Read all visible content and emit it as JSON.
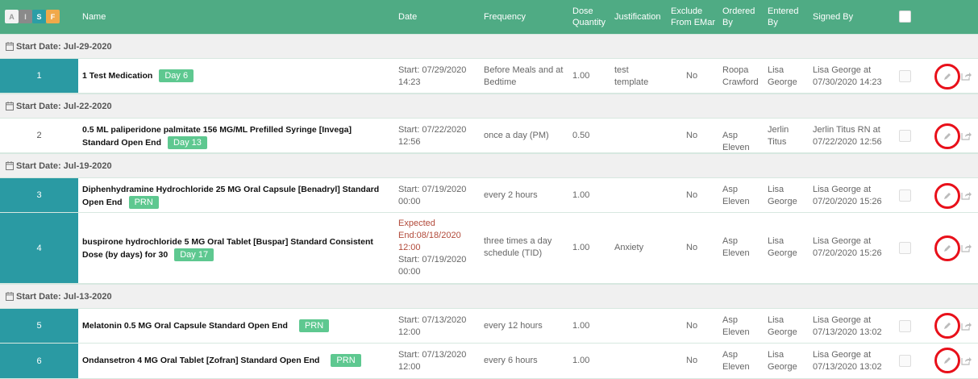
{
  "status_keys": [
    "A",
    "I",
    "S",
    "F"
  ],
  "columns": {
    "name": "Name",
    "date": "Date",
    "frequency": "Frequency",
    "dose_quantity": "Dose Quantity",
    "justification": "Justification",
    "exclude_emar": "Exclude From EMar",
    "ordered_by": "Ordered By",
    "entered_by": "Entered By",
    "signed_by": "Signed By"
  },
  "groups": [
    {
      "label": "Start Date: Jul-29-2020"
    },
    {
      "label": "Start Date: Jul-22-2020"
    },
    {
      "label": "Start Date: Jul-19-2020"
    },
    {
      "label": "Start Date: Jul-13-2020"
    }
  ],
  "rows": [
    {
      "num": "1",
      "name": "1 Test Medication",
      "tag": "Day 6",
      "expected": "",
      "date": "Start: 07/29/2020 14:23",
      "frequency": "Before Meals and at Bedtime",
      "dose": "1.00",
      "justification": "test template",
      "exclude": "No",
      "ordered_by": "Roopa Crawford",
      "entered_by": "Lisa George",
      "signed_by": "Lisa George at 07/30/2020 14:23"
    },
    {
      "num": "2",
      "name": "0.5 ML paliperidone palmitate 156 MG/ML Prefilled Syringe [Invega] Standard Open End",
      "tag": "Day 13",
      "expected": "",
      "date": "Start: 07/22/2020 12:56",
      "frequency": "once a day (PM)",
      "dose": "0.50",
      "justification": "",
      "exclude": "No",
      "ordered_by": "Asp Eleven",
      "entered_by": "Jerlin Titus",
      "signed_by": "Jerlin Titus RN at 07/22/2020 12:56"
    },
    {
      "num": "3",
      "name": "Diphenhydramine Hydrochloride 25 MG Oral Capsule [Benadryl] Standard Open End",
      "tag": "PRN",
      "expected": "",
      "date": "Start: 07/19/2020 00:00",
      "frequency": "every 2 hours",
      "dose": "1.00",
      "justification": "",
      "exclude": "No",
      "ordered_by": "Asp Eleven",
      "entered_by": "Lisa George",
      "signed_by": "Lisa George at 07/20/2020 15:26"
    },
    {
      "num": "4",
      "name": "buspirone hydrochloride 5 MG Oral Tablet [Buspar] Standard Consistent Dose (by days) for 30",
      "tag": "Day 17",
      "expected": "Expected End:08/18/2020 12:00",
      "date": "Start: 07/19/2020 00:00",
      "frequency": "three times a day schedule (TID)",
      "dose": "1.00",
      "justification": "Anxiety",
      "exclude": "No",
      "ordered_by": "Asp Eleven",
      "entered_by": "Lisa George",
      "signed_by": "Lisa George at 07/20/2020 15:26"
    },
    {
      "num": "5",
      "name": "Melatonin 0.5 MG Oral Capsule Standard Open End",
      "tag": "PRN",
      "expected": "",
      "date": "Start: 07/13/2020 12:00",
      "frequency": "every 12 hours",
      "dose": "1.00",
      "justification": "",
      "exclude": "No",
      "ordered_by": "Asp Eleven",
      "entered_by": "Lisa George",
      "signed_by": "Lisa George at 07/13/2020 13:02"
    },
    {
      "num": "6",
      "name": "Ondansetron 4 MG Oral Tablet [Zofran] Standard Open End",
      "tag": "PRN",
      "expected": "",
      "date": "Start: 07/13/2020 12:00",
      "frequency": "every 6 hours",
      "dose": "1.00",
      "justification": "",
      "exclude": "No",
      "ordered_by": "Asp Eleven",
      "entered_by": "Lisa George",
      "signed_by": "Lisa George at 07/13/2020 13:02"
    }
  ],
  "colors": {
    "header": "#4fab84",
    "row_number_active": "#2a9aa3",
    "tag": "#5ec890",
    "highlight_ring": "#e8101a",
    "expected_text": "#b24a3a"
  },
  "icons": {
    "group": "calendar-icon",
    "edit": "pencil-icon",
    "share": "share-icon"
  }
}
